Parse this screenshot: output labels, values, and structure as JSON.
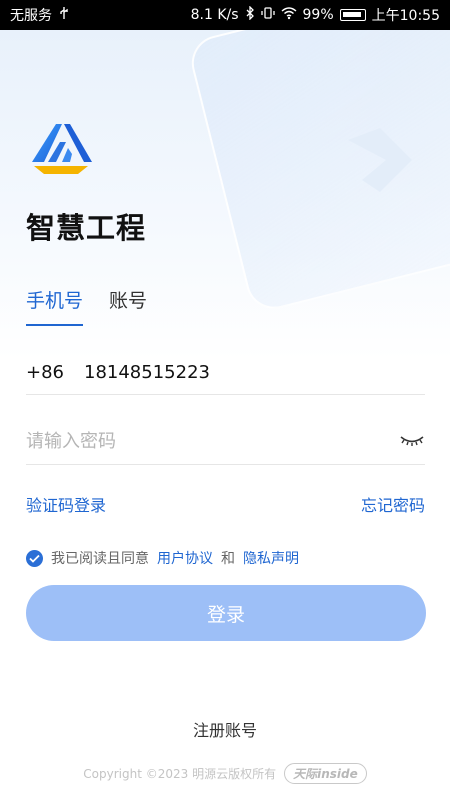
{
  "status_bar": {
    "carrier": "无服务",
    "usb_icon": "usb-icon",
    "speed": "8.1 K/s",
    "battery": "99%",
    "time": "上午10:55"
  },
  "app": {
    "title": "智慧工程"
  },
  "tabs": [
    {
      "label": "手机号",
      "active": true
    },
    {
      "label": "账号",
      "active": false
    }
  ],
  "phone": {
    "country_code": "+86",
    "value": "18148515223"
  },
  "password": {
    "placeholder": "请输入密码",
    "visibility_icon": "eye-closed-icon"
  },
  "links": {
    "sms_login": "验证码登录",
    "forgot_password": "忘记密码"
  },
  "agreement": {
    "checked": true,
    "prefix": "我已阅读且同意",
    "user_agreement": "用户协议",
    "and": "和",
    "privacy": "隐私声明"
  },
  "login_button": "登录",
  "register": "注册账号",
  "footer": {
    "copyright": "Copyright ©2023 明源云版权所有",
    "badge_main": "天际",
    "badge_suffix": "inside"
  },
  "colors": {
    "accent": "#1f66d1",
    "button": "#9dbff7"
  }
}
